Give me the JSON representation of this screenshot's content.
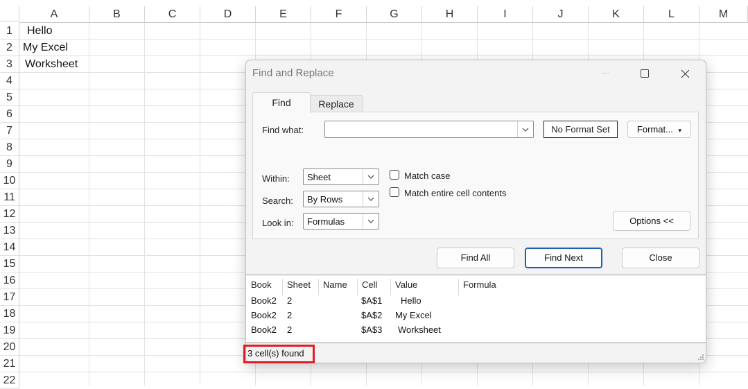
{
  "sheet": {
    "columns": [
      "A",
      "B",
      "C",
      "D",
      "E",
      "F",
      "G",
      "H",
      "I",
      "J",
      "K",
      "L",
      "M"
    ],
    "rows": [
      "1",
      "2",
      "3",
      "4",
      "5",
      "6",
      "7",
      "8",
      "9",
      "10",
      "11",
      "12",
      "13",
      "14",
      "15",
      "16",
      "17",
      "18",
      "19",
      "20",
      "21",
      "22"
    ],
    "cells": {
      "A1": "Hello",
      "A2": "My Excel",
      "A3": "Worksheet"
    }
  },
  "dialog": {
    "title": "Find and Replace",
    "tabs": {
      "find": "Find",
      "replace": "Replace"
    },
    "find_what_label": "Find what:",
    "find_what_value": "",
    "no_format_label": "No Format Set",
    "format_button": "Format...",
    "within_label": "Within:",
    "within_value": "Sheet",
    "search_label": "Search:",
    "search_value": "By Rows",
    "lookin_label": "Look in:",
    "lookin_value": "Formulas",
    "match_case_label": "Match case",
    "match_entire_label": "Match entire cell contents",
    "match_case_checked": false,
    "match_entire_checked": false,
    "options_button": "Options <<",
    "find_all_button": "Find All",
    "find_next_button": "Find Next",
    "close_button": "Close",
    "results": {
      "headers": [
        "Book",
        "Sheet",
        "Name",
        "Cell",
        "Value",
        "Formula"
      ],
      "rows": [
        {
          "book": "Book2",
          "sheet": "2",
          "name": "",
          "cell": "$A$1",
          "value": "Hello",
          "formula": ""
        },
        {
          "book": "Book2",
          "sheet": "2",
          "name": "",
          "cell": "$A$2",
          "value": "My Excel",
          "formula": ""
        },
        {
          "book": "Book2",
          "sheet": "2",
          "name": "",
          "cell": "$A$3",
          "value": "Worksheet",
          "formula": ""
        }
      ]
    },
    "status": "3 cell(s) found"
  },
  "colors": {
    "highlight": "#e41b23",
    "primary_border": "#1a5fb4"
  }
}
